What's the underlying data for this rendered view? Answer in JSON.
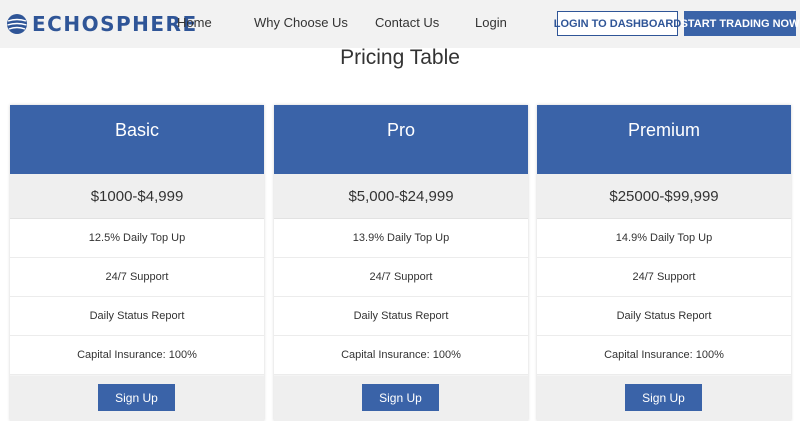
{
  "brand": {
    "name": "ECHOSPHERE",
    "color": "#2f5597",
    "icon": "globe-icon"
  },
  "nav": {
    "links": [
      "Home",
      "Why Choose Us",
      "Contact Us",
      "Login"
    ],
    "login_button": "LOGIN TO DASHBOARD",
    "start_button": "START TRADING NOW"
  },
  "page": {
    "title": "Pricing Table"
  },
  "colors": {
    "accent": "#3a63a8",
    "nav_bg": "#f2f2f2",
    "panel_bg": "#efefef"
  },
  "plans": [
    {
      "name": "Basic",
      "price": "$1000-$4,999",
      "features": [
        "12.5% Daily Top Up",
        "24/7 Support",
        "Daily Status Report",
        "Capital Insurance: 100%"
      ],
      "button": "Sign Up"
    },
    {
      "name": "Pro",
      "price": "$5,000-$24,999",
      "features": [
        "13.9% Daily Top Up",
        "24/7 Support",
        "Daily Status Report",
        "Capital Insurance: 100%"
      ],
      "button": "Sign Up"
    },
    {
      "name": "Premium",
      "price": "$25000-$99,999",
      "features": [
        "14.9% Daily Top Up",
        "24/7 Support",
        "Daily Status Report",
        "Capital Insurance: 100%"
      ],
      "button": "Sign Up"
    }
  ]
}
